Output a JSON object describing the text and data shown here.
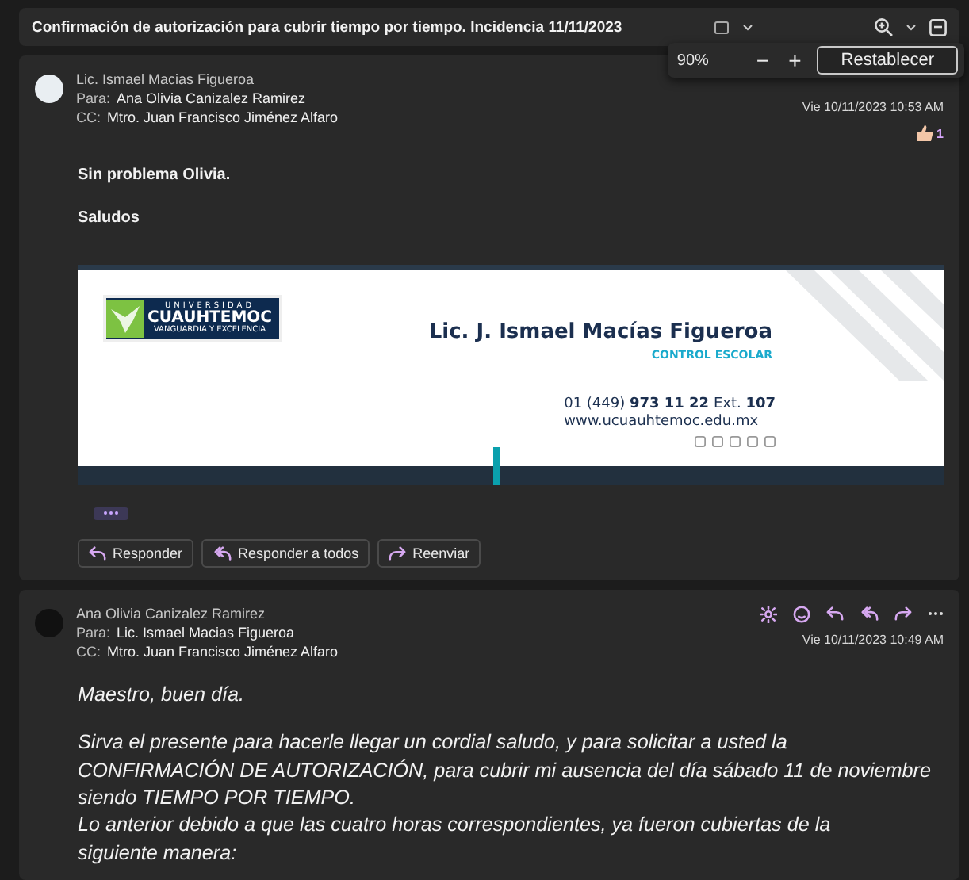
{
  "subject": "Confirmación de autorización para cubrir tiempo por tiempo. Incidencia 11/11/2023",
  "zoom": {
    "value": "90%",
    "minus": "−",
    "plus": "+",
    "reset": "Restablecer"
  },
  "messages": [
    {
      "from": "Lic. Ismael Macias Figueroa",
      "to_label": "Para:",
      "to": "Ana Olivia Canizalez Ramirez",
      "cc_label": "CC:",
      "cc": "Mtro. Juan Francisco Jiménez Alfaro",
      "date": "Vie 10/11/2023 10:53 AM",
      "reaction_count": "1",
      "bold": true,
      "italic": false,
      "paragraphs": [
        {
          "lines": [
            "Sin problema Olivia."
          ]
        },
        {
          "lines": [
            "Saludos"
          ]
        }
      ],
      "signature": {
        "logo_top": "UNIVERSIDAD",
        "logo_main": "CUAUHTEMOC",
        "logo_sub": "VANGUARDIA Y EXCELENCIA",
        "name": "Lic. J. Ismael Macías Figueroa",
        "department": "CONTROL ESCOLAR",
        "phone": "01 (449) **973 11 22** Ext. **107**",
        "website": "www.ucuauhtemoc.edu.mx"
      },
      "actions": [
        {
          "kind": "reply",
          "label": "Responder"
        },
        {
          "kind": "reply_all",
          "label": "Responder a todos"
        },
        {
          "kind": "forward",
          "label": "Reenviar"
        }
      ]
    },
    {
      "from": "Ana Olivia Canizalez Ramirez",
      "to_label": "Para:",
      "to": "Lic. Ismael Macias Figueroa",
      "cc_label": "CC:",
      "cc": "Mtro. Juan Francisco Jiménez Alfaro",
      "date": "Vie 10/11/2023 10:49 AM",
      "bold": false,
      "italic": true,
      "paragraphs": [
        {
          "lines": [
            "Maestro, buen día."
          ]
        },
        {
          "lines": [
            "Sirva el presente para hacerle llegar un cordial saludo, y para solicitar a usted la",
            "CONFIRMACIÓN DE AUTORIZACIÓN, para cubrir mi ausencia del día sábado 11 de noviembre",
            "siendo TIEMPO POR TIEMPO.",
            "Lo anterior debido a  que las cuatro horas correspondientes, ya fueron cubiertas de la",
            "siguiente manera:"
          ]
        }
      ]
    }
  ]
}
